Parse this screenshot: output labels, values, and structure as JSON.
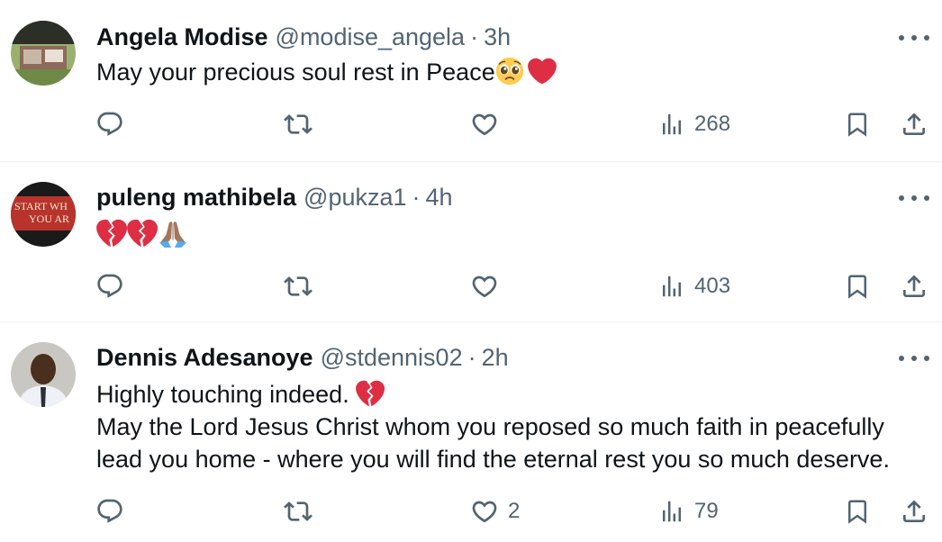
{
  "posts": [
    {
      "name": "Angela Modise",
      "handle": "@modise_angela",
      "dot": "·",
      "time": "3h",
      "lines": [
        "May your precious soul rest in Peace"
      ],
      "emojis": [
        "pleading-face",
        "red-heart"
      ],
      "stats": {
        "reply": "",
        "repost": "",
        "like": "",
        "views": "268"
      }
    },
    {
      "name": "puleng mathibela",
      "handle": "@pukza1",
      "dot": "·",
      "time": "4h",
      "lines": [
        ""
      ],
      "emojis": [
        "broken-heart",
        "broken-heart",
        "folded-hands"
      ],
      "avatar_text": [
        "START WH",
        "YOU AR"
      ],
      "stats": {
        "reply": "",
        "repost": "",
        "like": "",
        "views": "403"
      }
    },
    {
      "name": "Dennis Adesanoye",
      "handle": "@stdennis02",
      "dot": "·",
      "time": "2h",
      "lines": [
        "Highly touching indeed. ",
        "May the Lord Jesus Christ whom you reposed so much faith in peacefully",
        "lead you home - where you will find the eternal rest you so much deserve."
      ],
      "emojis": [
        "broken-heart"
      ],
      "stats": {
        "reply": "",
        "repost": "",
        "like": "2",
        "views": "79"
      }
    }
  ],
  "colors": {
    "text": "#0f1419",
    "secondary": "#536471",
    "divider": "#eff3f4",
    "heart": "#dd2e44"
  },
  "icons": [
    "reply-icon",
    "repost-icon",
    "like-icon",
    "views-icon",
    "bookmark-icon",
    "share-icon",
    "more-icon"
  ]
}
